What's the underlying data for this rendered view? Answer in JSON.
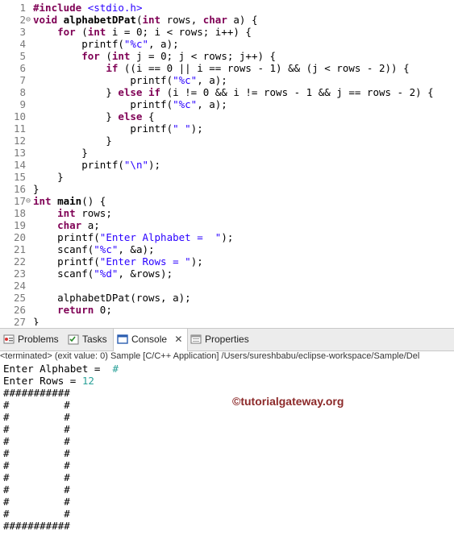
{
  "editor": {
    "lines": [
      {
        "num": "1",
        "fold": "",
        "code": [
          {
            "t": "#include ",
            "c": "kw"
          },
          {
            "t": "<stdio.h>",
            "c": "inc"
          }
        ]
      },
      {
        "num": "2",
        "fold": "⊖",
        "code": [
          {
            "t": "void ",
            "c": "kw"
          },
          {
            "t": "alphabetDPat",
            "c": "b"
          },
          {
            "t": "(",
            "c": ""
          },
          {
            "t": "int ",
            "c": "kw"
          },
          {
            "t": "rows, ",
            "c": ""
          },
          {
            "t": "char ",
            "c": "kw"
          },
          {
            "t": "a) {",
            "c": ""
          }
        ]
      },
      {
        "num": "3",
        "fold": "",
        "code": [
          {
            "t": "    ",
            "c": ""
          },
          {
            "t": "for ",
            "c": "kw"
          },
          {
            "t": "(",
            "c": ""
          },
          {
            "t": "int ",
            "c": "kw"
          },
          {
            "t": "i = 0; i < rows; i++) {",
            "c": ""
          }
        ]
      },
      {
        "num": "4",
        "fold": "",
        "code": [
          {
            "t": "        printf(",
            "c": ""
          },
          {
            "t": "\"%c\"",
            "c": "str"
          },
          {
            "t": ", a);",
            "c": ""
          }
        ]
      },
      {
        "num": "5",
        "fold": "",
        "code": [
          {
            "t": "        ",
            "c": ""
          },
          {
            "t": "for ",
            "c": "kw"
          },
          {
            "t": "(",
            "c": ""
          },
          {
            "t": "int ",
            "c": "kw"
          },
          {
            "t": "j = 0; j < rows; j++) {",
            "c": ""
          }
        ]
      },
      {
        "num": "6",
        "fold": "",
        "code": [
          {
            "t": "            ",
            "c": ""
          },
          {
            "t": "if ",
            "c": "kw"
          },
          {
            "t": "((i == 0 || i == rows - 1) && (j < rows - 2)) {",
            "c": ""
          }
        ]
      },
      {
        "num": "7",
        "fold": "",
        "code": [
          {
            "t": "                printf(",
            "c": ""
          },
          {
            "t": "\"%c\"",
            "c": "str"
          },
          {
            "t": ", a);",
            "c": ""
          }
        ]
      },
      {
        "num": "8",
        "fold": "",
        "code": [
          {
            "t": "            } ",
            "c": ""
          },
          {
            "t": "else if ",
            "c": "kw"
          },
          {
            "t": "(i != 0 && i != rows - 1 && j == rows - 2) {",
            "c": ""
          }
        ]
      },
      {
        "num": "9",
        "fold": "",
        "code": [
          {
            "t": "                printf(",
            "c": ""
          },
          {
            "t": "\"%c\"",
            "c": "str"
          },
          {
            "t": ", a);",
            "c": ""
          }
        ]
      },
      {
        "num": "10",
        "fold": "",
        "code": [
          {
            "t": "            } ",
            "c": ""
          },
          {
            "t": "else ",
            "c": "kw"
          },
          {
            "t": "{",
            "c": ""
          }
        ]
      },
      {
        "num": "11",
        "fold": "",
        "code": [
          {
            "t": "                printf(",
            "c": ""
          },
          {
            "t": "\" \"",
            "c": "str"
          },
          {
            "t": ");",
            "c": ""
          }
        ]
      },
      {
        "num": "12",
        "fold": "",
        "code": [
          {
            "t": "            }",
            "c": ""
          }
        ]
      },
      {
        "num": "13",
        "fold": "",
        "code": [
          {
            "t": "        }",
            "c": ""
          }
        ]
      },
      {
        "num": "14",
        "fold": "",
        "code": [
          {
            "t": "        printf(",
            "c": ""
          },
          {
            "t": "\"\\n\"",
            "c": "str"
          },
          {
            "t": ");",
            "c": ""
          }
        ]
      },
      {
        "num": "15",
        "fold": "",
        "code": [
          {
            "t": "    }",
            "c": ""
          }
        ]
      },
      {
        "num": "16",
        "fold": "",
        "code": [
          {
            "t": "}",
            "c": ""
          }
        ]
      },
      {
        "num": "17",
        "fold": "⊖",
        "code": [
          {
            "t": "int ",
            "c": "kw"
          },
          {
            "t": "main",
            "c": "b"
          },
          {
            "t": "() {",
            "c": ""
          }
        ]
      },
      {
        "num": "18",
        "fold": "",
        "code": [
          {
            "t": "    ",
            "c": ""
          },
          {
            "t": "int ",
            "c": "kw"
          },
          {
            "t": "rows;",
            "c": ""
          }
        ]
      },
      {
        "num": "19",
        "fold": "",
        "code": [
          {
            "t": "    ",
            "c": ""
          },
          {
            "t": "char ",
            "c": "kw"
          },
          {
            "t": "a;",
            "c": ""
          }
        ]
      },
      {
        "num": "20",
        "fold": "",
        "code": [
          {
            "t": "    printf(",
            "c": ""
          },
          {
            "t": "\"Enter Alphabet =  \"",
            "c": "str"
          },
          {
            "t": ");",
            "c": ""
          }
        ]
      },
      {
        "num": "21",
        "fold": "",
        "code": [
          {
            "t": "    scanf(",
            "c": ""
          },
          {
            "t": "\"%c\"",
            "c": "str"
          },
          {
            "t": ", &a);",
            "c": ""
          }
        ]
      },
      {
        "num": "22",
        "fold": "",
        "code": [
          {
            "t": "    printf(",
            "c": ""
          },
          {
            "t": "\"Enter Rows = \"",
            "c": "str"
          },
          {
            "t": ");",
            "c": ""
          }
        ]
      },
      {
        "num": "23",
        "fold": "",
        "code": [
          {
            "t": "    scanf(",
            "c": ""
          },
          {
            "t": "\"%d\"",
            "c": "str"
          },
          {
            "t": ", &rows);",
            "c": ""
          }
        ]
      },
      {
        "num": "24",
        "fold": "",
        "code": [
          {
            "t": "",
            "c": ""
          }
        ]
      },
      {
        "num": "25",
        "fold": "",
        "code": [
          {
            "t": "    alphabetDPat(rows, a);",
            "c": ""
          }
        ]
      },
      {
        "num": "26",
        "fold": "",
        "code": [
          {
            "t": "    ",
            "c": ""
          },
          {
            "t": "return ",
            "c": "kw"
          },
          {
            "t": "0;",
            "c": ""
          }
        ]
      },
      {
        "num": "27",
        "fold": "",
        "code": [
          {
            "t": "}",
            "c": ""
          }
        ]
      }
    ]
  },
  "tabs": {
    "problems": "Problems",
    "tasks": "Tasks",
    "console": "Console",
    "close": "✕",
    "properties": "Properties"
  },
  "console": {
    "status": "<terminated> (exit value: 0) Sample [C/C++ Application] /Users/sureshbabu/eclipse-workspace/Sample/Del",
    "prompt_alpha": "Enter Alphabet =  ",
    "input_alpha": "#",
    "prompt_rows": "Enter Rows = ",
    "input_rows": "12",
    "output": [
      "###########",
      "#         #",
      "#         #",
      "#         #",
      "#         #",
      "#         #",
      "#         #",
      "#         #",
      "#         #",
      "#         #",
      "#         #",
      "###########"
    ],
    "watermark": "©tutorialgateway.org"
  },
  "colors": {
    "keyword": "#7f0055",
    "string": "#2a00ff",
    "user_input": "#2aa198"
  }
}
